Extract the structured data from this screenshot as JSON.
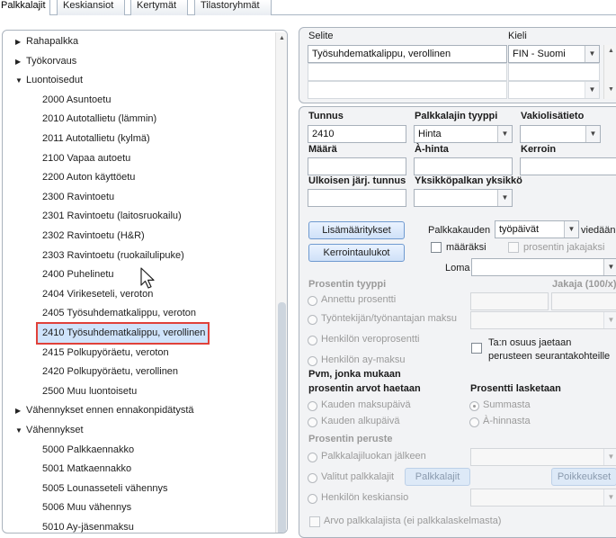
{
  "tabs": [
    "Palkkalajit",
    "Keskiansiot",
    "Kertymät",
    "Tilastoryhmät"
  ],
  "tree": {
    "items": [
      {
        "label": "Rahapalkka",
        "level": 0,
        "expanded": false
      },
      {
        "label": "Työkorvaus",
        "level": 0,
        "expanded": false
      },
      {
        "label": "Luontoisedut",
        "level": 0,
        "expanded": true
      },
      {
        "label": "2000 Asuntoetu",
        "level": 1
      },
      {
        "label": "2010 Autotallietu (lämmin)",
        "level": 1
      },
      {
        "label": "2011 Autotallietu (kylmä)",
        "level": 1
      },
      {
        "label": "2100 Vapaa autoetu",
        "level": 1
      },
      {
        "label": "2200 Auton käyttöetu",
        "level": 1
      },
      {
        "label": "2300 Ravintoetu",
        "level": 1
      },
      {
        "label": "2301 Ravintoetu (laitosruokailu)",
        "level": 1
      },
      {
        "label": "2302 Ravintoetu (H&R)",
        "level": 1
      },
      {
        "label": "2303 Ravintoetu (ruokailulipuke)",
        "level": 1
      },
      {
        "label": "2400 Puhelinetu",
        "level": 1
      },
      {
        "label": "2404 Virikeseteli, veroton",
        "level": 1
      },
      {
        "label": "2405 Työsuhdematkalippu, veroton",
        "level": 1
      },
      {
        "label": "2410 Työsuhdematkalippu, verollinen",
        "level": 1,
        "selected": true
      },
      {
        "label": "2415 Polkupyöräetu, veroton",
        "level": 1
      },
      {
        "label": "2420 Polkupyöräetu, verollinen",
        "level": 1
      },
      {
        "label": "2500 Muu luontoisetu",
        "level": 1
      },
      {
        "label": "Vähennykset ennen ennakonpidätystä",
        "level": 0,
        "expanded": false
      },
      {
        "label": "Vähennykset",
        "level": 0,
        "expanded": true
      },
      {
        "label": "5000 Palkkaennakko",
        "level": 1
      },
      {
        "label": "5001 Matkaennakko",
        "level": 1
      },
      {
        "label": "5005 Lounasseteli vähennys",
        "level": 1
      },
      {
        "label": "5006 Muu vähennys",
        "level": 1
      },
      {
        "label": "5010 Ay-jäsenmaksu",
        "level": 1
      }
    ]
  },
  "desc_grid": {
    "col_selite": "Selite",
    "col_kieli": "Kieli",
    "rows": [
      {
        "selite": "Työsuhdematkalippu, verollinen",
        "kieli": "FIN - Suomi"
      },
      {
        "selite": "",
        "kieli": ""
      },
      {
        "selite": "",
        "kieli": ""
      }
    ]
  },
  "form": {
    "tunnus_label": "Tunnus",
    "tunnus_value": "2410",
    "tyyppi_label": "Palkkalajin tyyppi",
    "tyyppi_value": "Hinta",
    "vakio_label": "Vakiolisätieto",
    "vakio_value": "",
    "maara_label": "Määrä",
    "ahinta_label": "À-hinta",
    "kerroin_label": "Kerroin",
    "ulkoinen_label": "Ulkoisen järj. tunnus",
    "yksikko_label": "Yksikköpalkan yksikkö",
    "lisamaaritykset_btn": "Lisämääritykset",
    "kerrointaulukot_btn": "Kerrointaulukot",
    "palkkakauden_label": "Palkkakauden",
    "palkkakauden_value": "työpäivät",
    "viedaan_label": "viedään",
    "maaraksi_label": "määräksi",
    "prosentin_jakajaksi_label": "prosentin jakajaksi",
    "loma_label": "Loma",
    "loma_value": "",
    "prosentin_tyyppi_label": "Prosentin tyyppi",
    "jakaja_label": "Jakaja (100/x)",
    "annettu_prosentti": "Annettu prosentti",
    "tyontekijan_maksu": "Työntekijän/työnantajan maksu",
    "henkilon_veroprosentti": "Henkilön veroprosentti",
    "henkilon_ay_maksu": "Henkilön ay-maksu",
    "ta_osuus_line1": "Ta:n osuus jaetaan",
    "ta_osuus_line2": "perusteen seurantakohteille",
    "pvm_label_line1": "Pvm, jonka mukaan",
    "pvm_label_line2": "prosentin arvot haetaan",
    "kauden_maksupaiva": "Kauden maksupäivä",
    "kauden_alkupaiva": "Kauden alkupäivä",
    "prosentti_lasketaan": "Prosentti lasketaan",
    "summasta": "Summasta",
    "a_hinnasta": "À-hinnasta",
    "prosentin_peruste": "Prosentin peruste",
    "palkkalajiluokan_jalkeen": "Palkkalajiluokan jälkeen",
    "valitut_palkkalajit": "Valitut palkkalajit",
    "palkkalajit_btn": "Palkkalajit",
    "poikkeukset_btn": "Poikkeukset",
    "henkilon_keskiansio": "Henkilön keskiansio",
    "arvo_palkkalajista": "Arvo palkkalajista (ei palkkalaskelmasta)"
  }
}
